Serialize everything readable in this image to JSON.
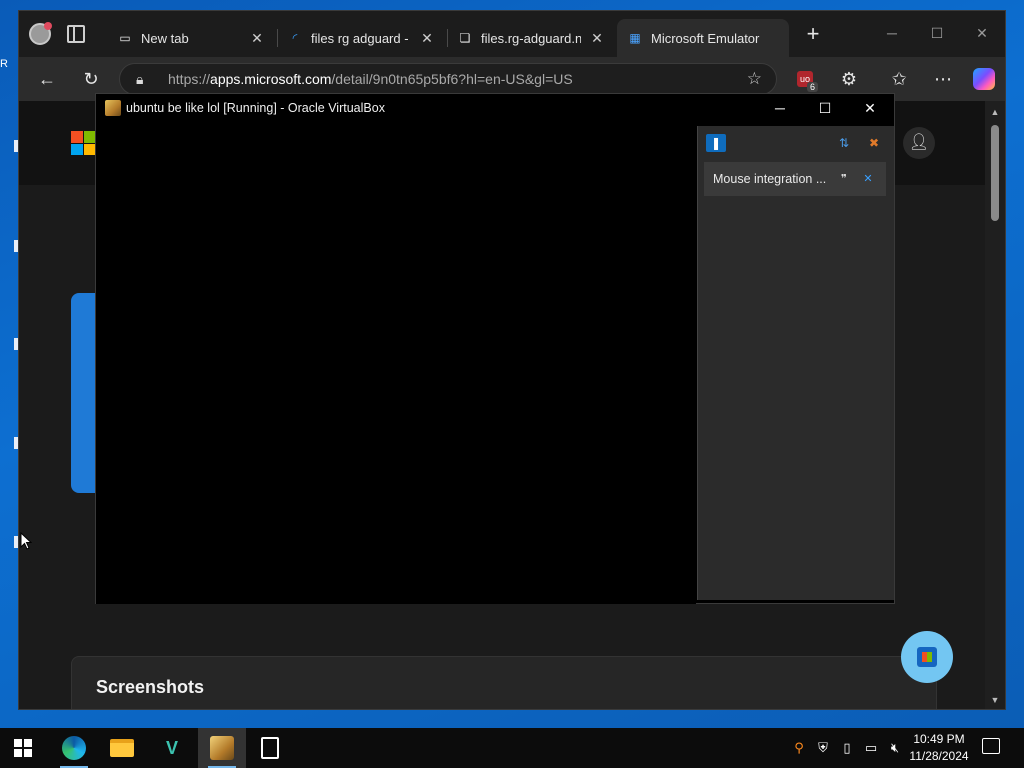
{
  "browser": {
    "tabs": [
      {
        "label": "New tab",
        "icon": "new-tab-icon"
      },
      {
        "label": "files rg adguard - Se",
        "icon": "loading-icon"
      },
      {
        "label": "files.rg-adguard.net",
        "icon": "page-icon"
      },
      {
        "label": "Microsoft Emulator",
        "icon": "microsoft-store-icon"
      }
    ],
    "close_glyph": "✕",
    "new_tab_glyph": "+",
    "address": {
      "prefix": "https://",
      "domain": "apps.microsoft.com",
      "path": "/detail/9n0tn65p5bf6?hl=en-US&gl=US"
    },
    "extension_badge": "6",
    "extension_label": "uo"
  },
  "page": {
    "section_title": "Screenshots"
  },
  "vbox": {
    "title": "ubuntu be like lol [Running] - Oracle VirtualBox",
    "notification": {
      "text": "Mouse integration ..."
    }
  },
  "taskbar": {
    "time": "10:49 PM",
    "date": "11/28/2024"
  },
  "colors": {
    "accent": "#0f6cbd",
    "desktop": "#0b5cb4",
    "fab": "#73c6f2"
  }
}
